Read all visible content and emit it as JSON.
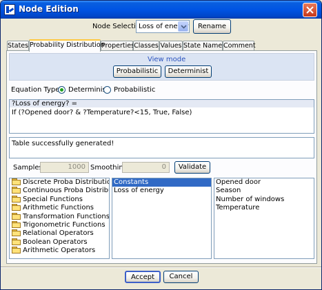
{
  "window": {
    "title": "Node Edition"
  },
  "node_selection": {
    "label": "Node Selection:",
    "value": "Loss of energy",
    "rename_label": "Rename"
  },
  "tabs": [
    {
      "label": "States"
    },
    {
      "label": "Probability Distribution"
    },
    {
      "label": "Properties"
    },
    {
      "label": "Classes"
    },
    {
      "label": "Values"
    },
    {
      "label": "State Names"
    },
    {
      "label": "Comment"
    }
  ],
  "view_mode": {
    "label": "View mode",
    "probabilistic_label": "Probabilistic",
    "determinist_label": "Determinist"
  },
  "equation_type": {
    "label": "Equation Type:",
    "determinist_label": "Determinist",
    "probabilistic_label": "Probabilistic",
    "selected": "Determinist"
  },
  "equation": {
    "line1": "?Loss of energy? =",
    "line2": "If (?Opened door? & ?Temperature?<15, True, False)"
  },
  "status": {
    "message": "Table successfully generated!"
  },
  "sampling": {
    "samples_label": "Samples:",
    "samples_value": "1000",
    "smoothing_label": "Smoothing:",
    "smoothing_value": "0",
    "validate_label": "Validate"
  },
  "function_categories": [
    "Discrete Proba Distributions",
    "Continuous Proba Distributions",
    "Special Functions",
    "Arithmetic Functions",
    "Transformation Functions",
    "Trigonometric Functions",
    "Relational Operators",
    "Boolean Operators",
    "Arithmetic Operators"
  ],
  "middle_list": [
    "Constants",
    "Loss of energy"
  ],
  "middle_selected": "Constants",
  "variables": [
    "Opened door",
    "Season",
    "Number of windows",
    "Temperature"
  ],
  "footer": {
    "accept_label": "Accept",
    "cancel_label": "Cancel"
  },
  "colors": {
    "title_bar": "#0054e3",
    "selection": "#316ac5",
    "link": "#2a52be",
    "tab_highlight": "#ffc83c"
  }
}
